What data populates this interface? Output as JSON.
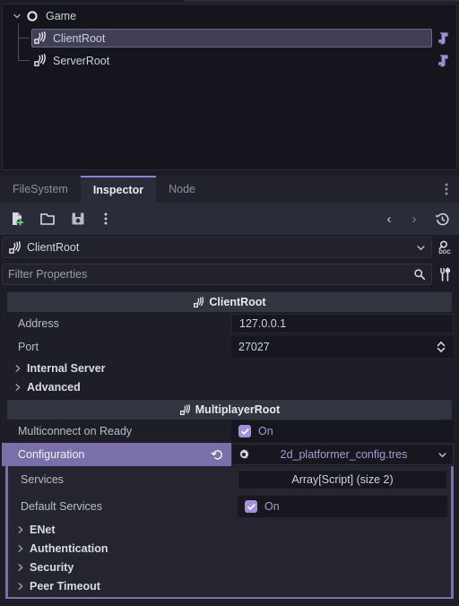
{
  "scene_tree": {
    "nodes": [
      {
        "label": "Game",
        "icon": "node2d-icon",
        "expanded": true,
        "depth": 0,
        "selected": false,
        "has_script": false
      },
      {
        "label": "ClientRoot",
        "icon": "multiplayer-root-icon",
        "depth": 1,
        "selected": true,
        "has_script": true
      },
      {
        "label": "ServerRoot",
        "icon": "multiplayer-root-icon",
        "depth": 1,
        "selected": false,
        "has_script": true
      }
    ]
  },
  "dock": {
    "tabs": [
      {
        "label": "FileSystem",
        "active": false
      },
      {
        "label": "Inspector",
        "active": true
      },
      {
        "label": "Node",
        "active": false
      }
    ],
    "overflow_menu": "tabs-overflow-menu"
  },
  "toolbar": {
    "new_resource": "new-resource-icon",
    "open_resource": "open-resource-icon",
    "save_resource": "save-resource-icon",
    "extra_menu": "resource-extra-menu-icon",
    "history_back": "‹",
    "history_forward": "›",
    "history": "history-icon"
  },
  "node_selector": {
    "name": "ClientRoot",
    "icon": "multiplayer-root-icon",
    "dropdown": "chevron-down-icon",
    "open_docs": "open-documentation-icon"
  },
  "search": {
    "placeholder": "Filter Properties",
    "value": "",
    "search_icon": "search-icon",
    "tools_icon": "object-tools-icon"
  },
  "inspector": {
    "sections": [
      {
        "type": "category",
        "title": "ClientRoot",
        "icon": "multiplayer-root-icon"
      },
      {
        "type": "property",
        "name": "Address",
        "value": "127.0.0.1",
        "control": "text"
      },
      {
        "type": "property",
        "name": "Port",
        "value": "27027",
        "control": "spinbox"
      },
      {
        "type": "group",
        "name": "Internal Server",
        "expanded": false
      },
      {
        "type": "group",
        "name": "Advanced",
        "expanded": false
      },
      {
        "type": "category",
        "title": "MultiplayerRoot",
        "icon": "multiplayer-root-icon"
      },
      {
        "type": "property",
        "name": "Multiconnect on Ready",
        "value": "On",
        "control": "checkbox",
        "checked": true
      },
      {
        "type": "property",
        "name": "Configuration",
        "value": "2d_platformer_config.tres",
        "control": "resource",
        "selected": true,
        "revert": "revert-icon",
        "resource_icon": "gear-icon",
        "dropdown": "chevron-down-icon"
      }
    ],
    "sub_inspector": {
      "rows": [
        {
          "type": "property",
          "name": "Services",
          "value": "Array[Script] (size 2)",
          "control": "array"
        },
        {
          "type": "property",
          "name": "Default Services",
          "value": "On",
          "control": "checkbox",
          "checked": true
        },
        {
          "type": "group",
          "name": "ENet",
          "expanded": false
        },
        {
          "type": "group",
          "name": "Authentication",
          "expanded": false
        },
        {
          "type": "group",
          "name": "Security",
          "expanded": false
        },
        {
          "type": "group",
          "name": "Peer Timeout",
          "expanded": false
        }
      ]
    }
  },
  "colors": {
    "accent": "#7a6fa8",
    "checkbox": "#a590dc",
    "script_icon": "#9d8fd6",
    "panel_bg": "#1d1e27",
    "tab_active_bg": "#2a2c38",
    "category_bg": "#32343f",
    "selection": "#413e58"
  }
}
